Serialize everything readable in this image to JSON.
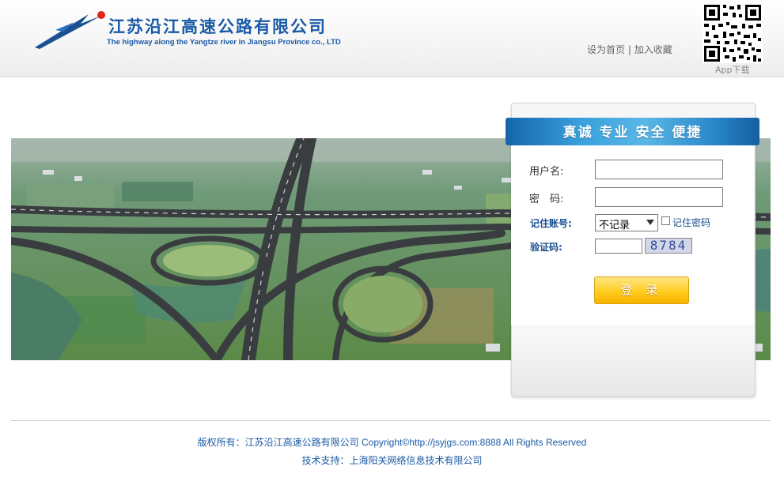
{
  "header": {
    "company_cn": "江苏沿江高速公路有限公司",
    "company_en": "The highway along the Yangtze river in Jiangsu Province co., LTD",
    "link_homepage": "设为首页",
    "separator": "|",
    "link_favorite": "加入收藏",
    "app_download": "App下载"
  },
  "login": {
    "title": "真诚 专业 安全 便捷",
    "username_label": "用户名:",
    "username_value": "",
    "password_label": "密　码:",
    "password_value": "",
    "remember_account_label": "记住账号:",
    "remember_account_selected": "不记录",
    "remember_password_label": "记住密码",
    "remember_password_checked": false,
    "captcha_label": "验证码:",
    "captcha_value": "",
    "captcha_image_text": "8784",
    "login_button": "登 录"
  },
  "footer": {
    "copyright": "版权所有：江苏沿江高速公路有限公司 Copyright©http://jsyjgs.com:8888 All Rights Reserved",
    "tech_support": "技术支持：上海阳关网络信息技术有限公司"
  },
  "colors": {
    "brand_blue": "#1a5aa6",
    "ribbon_blue": "#2d8ccc",
    "button_yellow": "#ffcc1f"
  }
}
